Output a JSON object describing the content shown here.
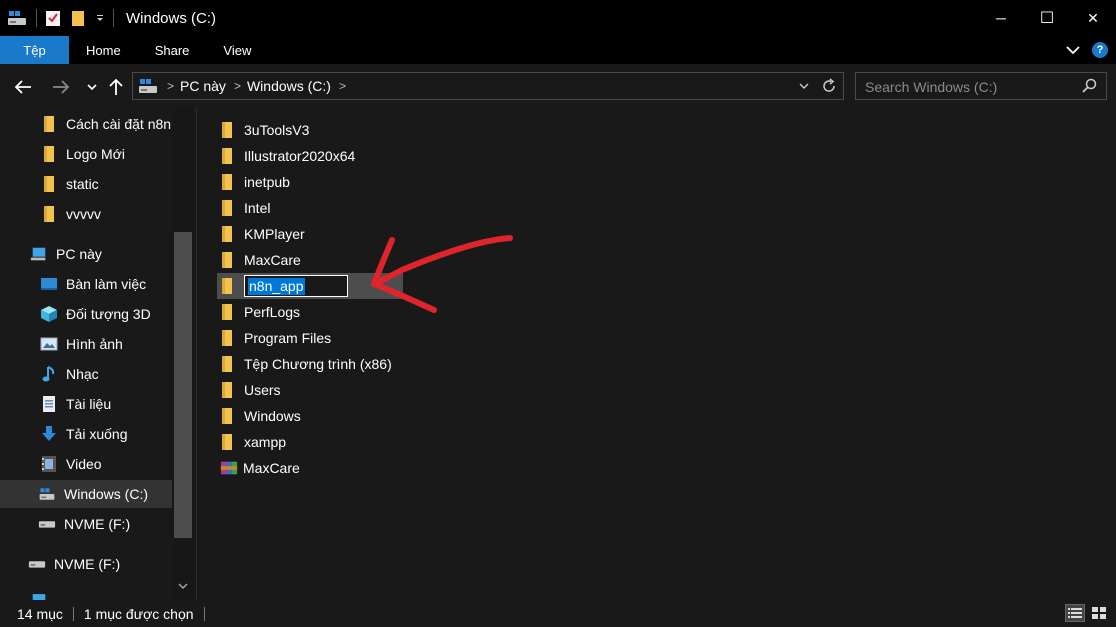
{
  "window": {
    "title": "Windows (C:)",
    "controls": {
      "minimize": "─",
      "maximize": "☐",
      "close": "✕"
    }
  },
  "ribbon": {
    "tabs": [
      "Tệp",
      "Home",
      "Share",
      "View"
    ],
    "help": "?"
  },
  "nav": {
    "breadcrumb": [
      "PC này",
      "Windows (C:)"
    ],
    "search_placeholder": "Search Windows (C:)"
  },
  "sidebar": {
    "quick_access": [
      {
        "label": "Cách cài đặt n8n",
        "icon": "folder-icon"
      },
      {
        "label": "Logo Mới",
        "icon": "folder-icon"
      },
      {
        "label": "static",
        "icon": "folder-icon"
      },
      {
        "label": "vvvvv",
        "icon": "folder-icon"
      }
    ],
    "this_pc": {
      "label": "PC này",
      "icon": "computer-icon"
    },
    "pc_items": [
      {
        "label": "Bàn làm việc",
        "icon": "desktop-icon"
      },
      {
        "label": "Đối tượng 3D",
        "icon": "cube-icon"
      },
      {
        "label": "Hình ảnh",
        "icon": "picture-icon"
      },
      {
        "label": "Nhạc",
        "icon": "music-icon"
      },
      {
        "label": "Tài liệu",
        "icon": "document-icon"
      },
      {
        "label": "Tải xuống",
        "icon": "download-icon"
      },
      {
        "label": "Video",
        "icon": "video-icon"
      },
      {
        "label": "Windows (C:)",
        "icon": "system-drive-icon",
        "selected": true
      },
      {
        "label": "NVME (F:)",
        "icon": "drive-icon"
      }
    ],
    "external": {
      "label": "NVME (F:)",
      "icon": "drive-icon"
    }
  },
  "files": [
    {
      "name": "3uToolsV3",
      "type": "folder"
    },
    {
      "name": "Illustrator2020x64",
      "type": "folder"
    },
    {
      "name": "inetpub",
      "type": "folder"
    },
    {
      "name": "Intel",
      "type": "folder"
    },
    {
      "name": "KMPlayer",
      "type": "folder"
    },
    {
      "name": "MaxCare",
      "type": "folder"
    },
    {
      "name": "n8n_app",
      "type": "folder",
      "renaming": true
    },
    {
      "name": "PerfLogs",
      "type": "folder"
    },
    {
      "name": "Program Files",
      "type": "folder"
    },
    {
      "name": "Tệp Chương trình (x86)",
      "type": "folder"
    },
    {
      "name": "Users",
      "type": "folder"
    },
    {
      "name": "Windows",
      "type": "folder"
    },
    {
      "name": "xampp",
      "type": "folder"
    },
    {
      "name": "MaxCare",
      "type": "archive"
    }
  ],
  "status": {
    "item_count": "14 mục",
    "selected": "1 mục được chọn"
  },
  "colors": {
    "accent": "#1979ca",
    "selection": "#0078d7",
    "folder": "#f2c24f",
    "annotation": "#e0242b"
  }
}
